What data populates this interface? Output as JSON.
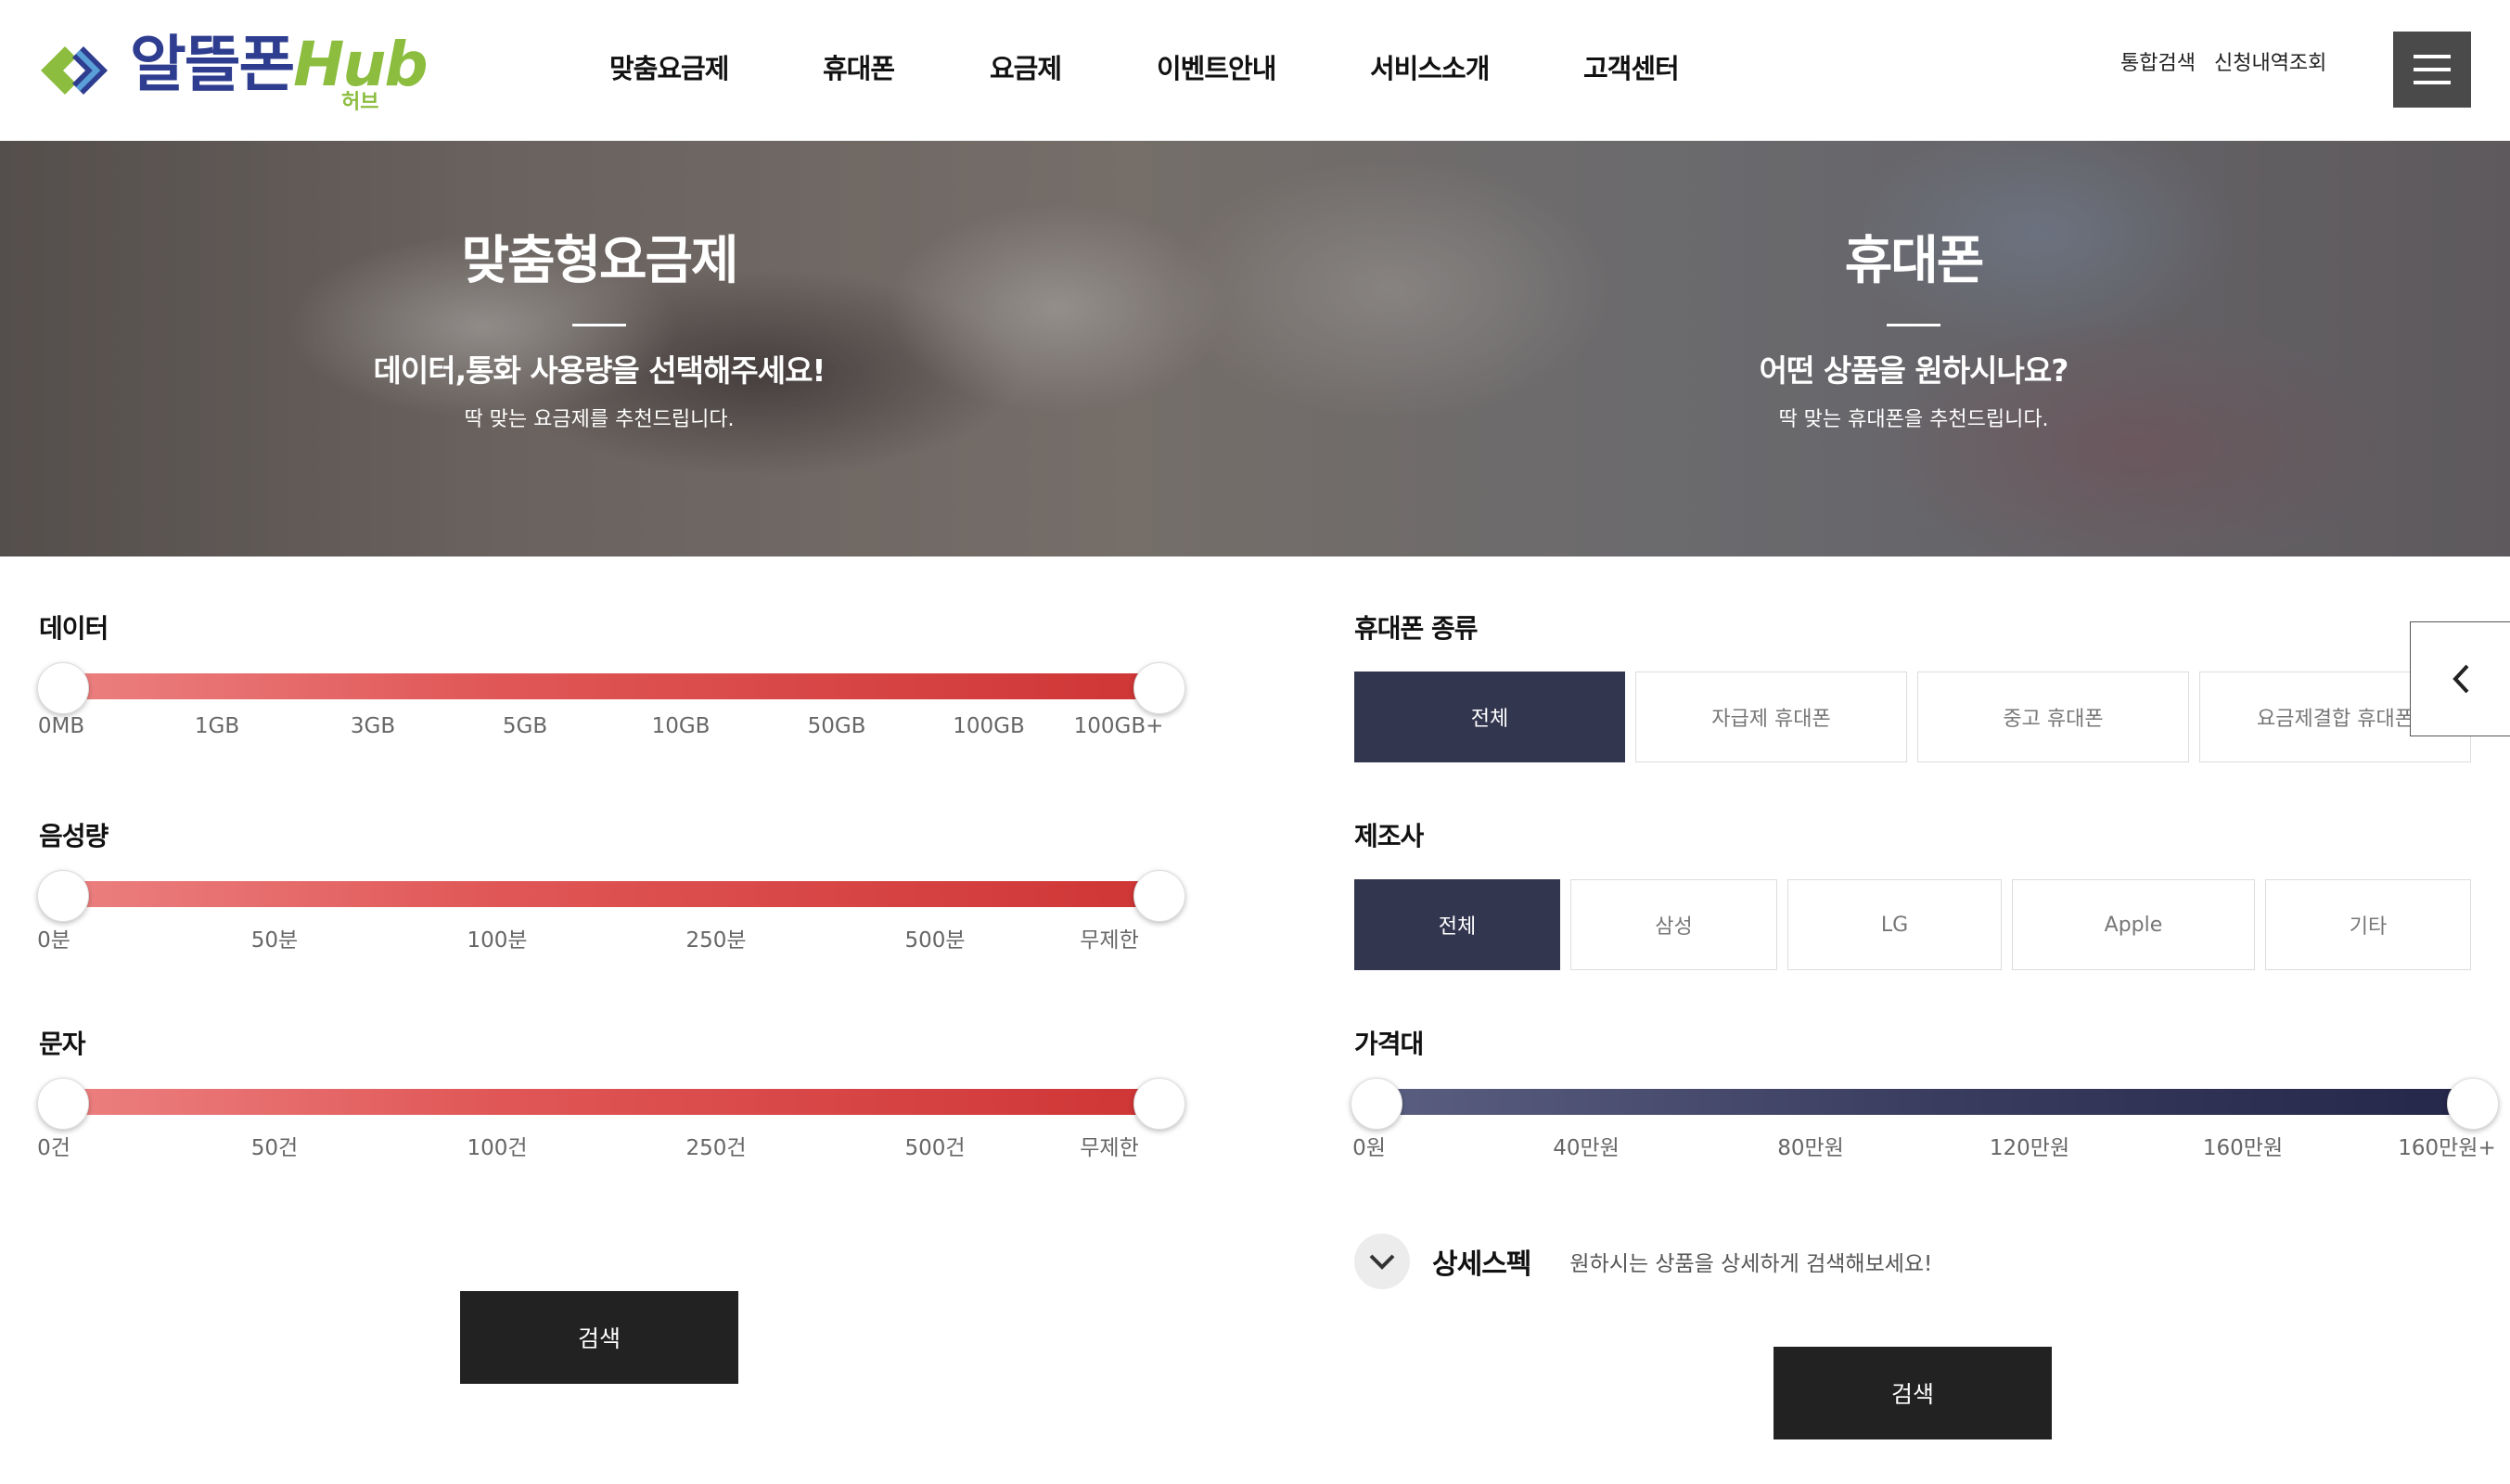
{
  "header": {
    "logo_main": "알뜰폰",
    "logo_hub": "Hub",
    "logo_sub": "허브",
    "nav": [
      "맞춤요금제",
      "휴대폰",
      "요금제",
      "이벤트안내",
      "서비스소개",
      "고객센터"
    ],
    "util": [
      "통합검색",
      "신청내역조회"
    ]
  },
  "hero": {
    "left": {
      "title": "맞춤형요금제",
      "subtitle": "데이터,통화 사용량을 선택해주세요!",
      "desc": "딱 맞는 요금제를 추천드립니다."
    },
    "right": {
      "title": "휴대폰",
      "subtitle": "어떤 상품을 원하시나요?",
      "desc": "딱 맞는 휴대폰을 추천드립니다."
    }
  },
  "plan": {
    "data": {
      "label": "데이터",
      "ticks": [
        "0MB",
        "1GB",
        "3GB",
        "5GB",
        "10GB",
        "50GB",
        "100GB",
        "100GB+"
      ],
      "range": [
        0,
        1
      ]
    },
    "voice": {
      "label": "음성량",
      "ticks": [
        "0분",
        "50분",
        "100분",
        "250분",
        "500분",
        "무제한"
      ],
      "range": [
        0,
        1
      ]
    },
    "sms": {
      "label": "문자",
      "ticks": [
        "0건",
        "50건",
        "100건",
        "250건",
        "500건",
        "무제한"
      ],
      "range": [
        0,
        1
      ]
    },
    "search_label": "검색"
  },
  "phone": {
    "type": {
      "label": "휴대폰 종류",
      "options": [
        "전체",
        "자급제 휴대폰",
        "중고 휴대폰",
        "요금제결합 휴대폰"
      ],
      "selected": "전체"
    },
    "maker": {
      "label": "제조사",
      "options": [
        "전체",
        "삼성",
        "LG",
        "Apple",
        "기타"
      ],
      "selected": "전체"
    },
    "price": {
      "label": "가격대",
      "ticks": [
        "0원",
        "40만원",
        "80만원",
        "120만원",
        "160만원",
        "160만원+"
      ],
      "range": [
        0,
        1
      ]
    },
    "spec": {
      "title": "상세스펙",
      "desc": "원하시는 상품을 상세하게 검색해보세요!"
    },
    "search_label": "검색"
  },
  "colors": {
    "accent_red": "#d23a3a",
    "navy": "#33364f",
    "logo_blue": "#2e3d8f",
    "logo_green": "#8cbd3f",
    "button_dark": "#222222"
  }
}
